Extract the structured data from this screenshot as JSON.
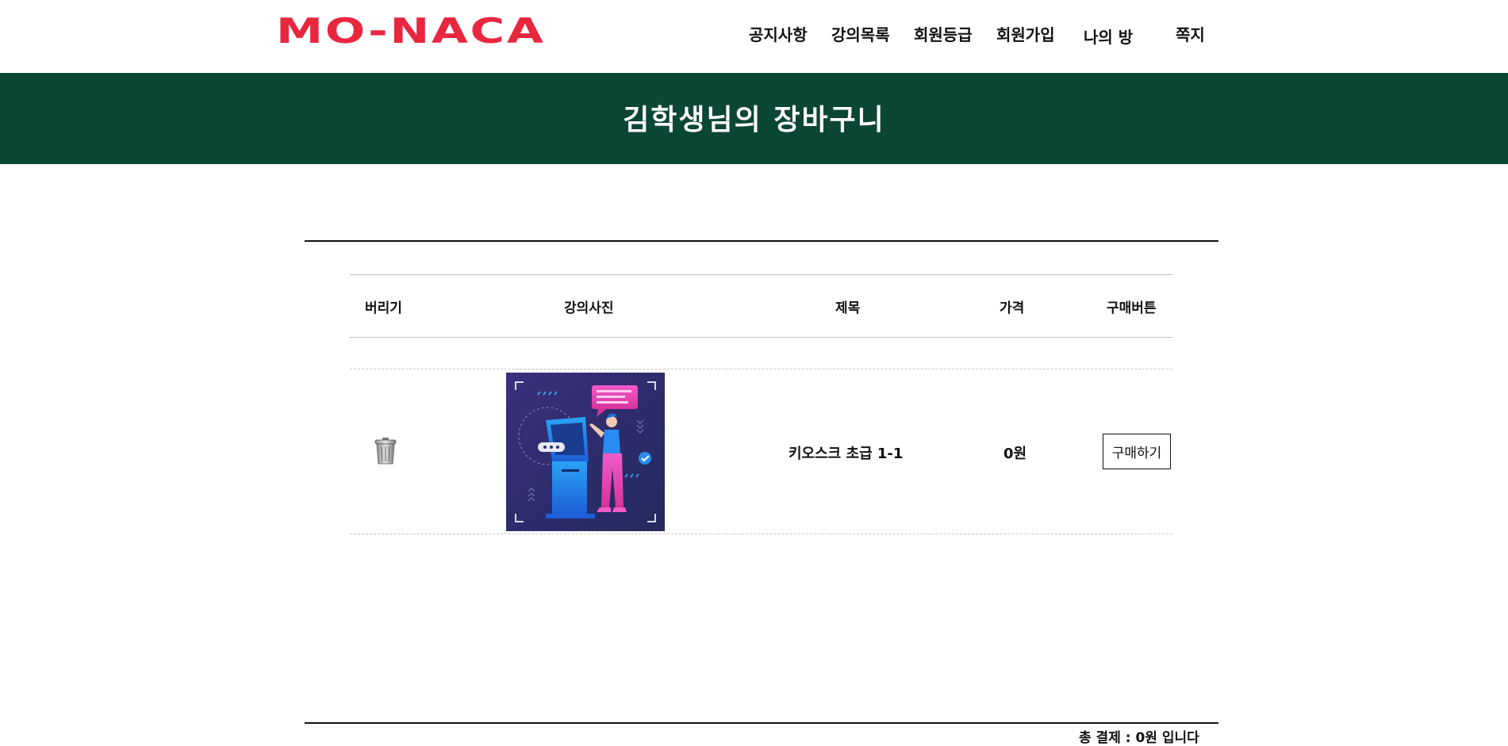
{
  "header": {
    "logo": "MO-NACA",
    "nav": [
      "공지사항",
      "강의목록",
      "회원등급",
      "회원가입",
      "나의 방",
      "쪽지"
    ]
  },
  "banner": {
    "title": "김학생님의 장바구니"
  },
  "table": {
    "headers": [
      "버리기",
      "강의사진",
      "제목",
      "가격",
      "구매버튼"
    ],
    "rows": [
      {
        "title": "키오스크 초급 1-1",
        "price": "0원",
        "buy_label": "구매하기",
        "image_icon": "kiosk-illustration",
        "delete_icon": "trash-can-icon"
      }
    ]
  },
  "footer": {
    "total_text": "총 결제 : 0원 입니다"
  },
  "colors": {
    "brand": "#e8273f",
    "banner": "#0c4634"
  }
}
